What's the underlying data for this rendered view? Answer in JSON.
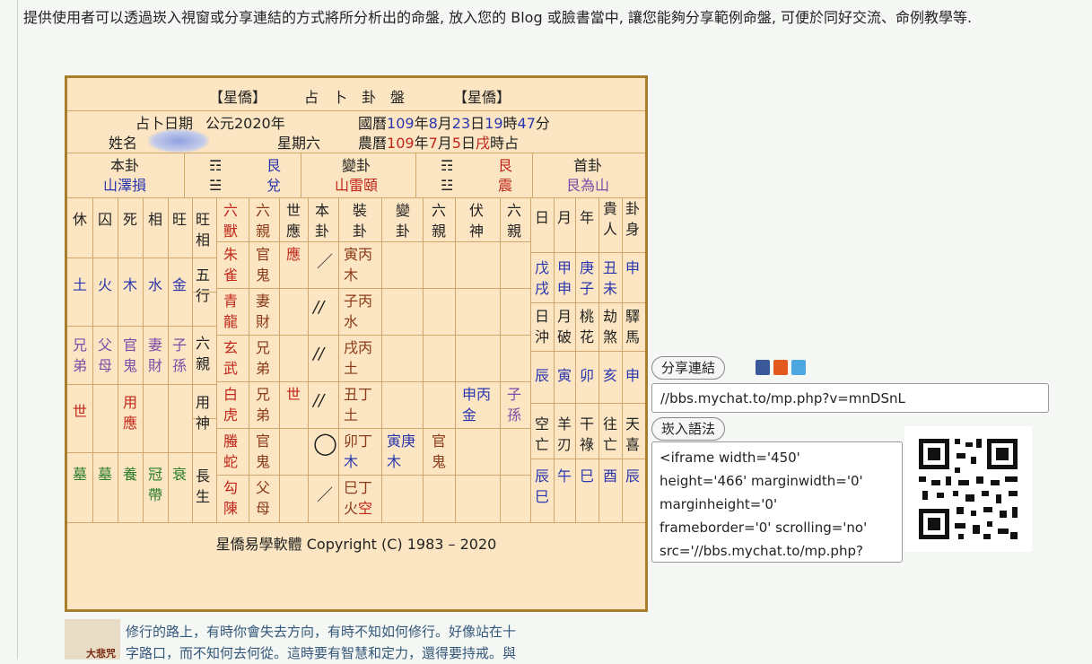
{
  "intro": {
    "text": "提供使用者可以透過崁入視窗或分享連結的方式將所分析出的命盤, 放入您的 Blog 或臉書當中, 讓您能夠分享範例命盤, 可便於同好交流、命例教學等."
  },
  "chart": {
    "title_left": "【星僑】",
    "title_mid": "占　卜　卦　盤",
    "title_right": "【星僑】",
    "date_label": "占卜日期",
    "gregorian_year": "公元2020年",
    "guoli": "國曆",
    "guoli_year": "109",
    "guoli_y": "年",
    "guoli_month": "8",
    "guoli_m": "月",
    "guoli_day": "23",
    "guoli_d": "日",
    "guoli_hour": "19",
    "guoli_h": "時",
    "guoli_min": "47",
    "guoli_mi": "分",
    "name_label": "姓名",
    "weekday": "星期六",
    "nongli": "農曆",
    "nongli_year": "109",
    "nongli_y": "年",
    "nongli_month": "7",
    "nongli_m": "月",
    "nongli_day": "5",
    "nongli_d": "日",
    "nongli_shi": "戌",
    "nongli_tail": "時占",
    "ben_gua_label": "本卦",
    "ben_gua_name": "山澤損",
    "ben_upper": "艮",
    "ben_lower": "兌",
    "bian_gua_label": "變卦",
    "bian_gua_name": "山雷頤",
    "bian_upper": "艮",
    "bian_lower": "震",
    "shou_gua_label": "首卦",
    "shou_gua_name": "艮為山",
    "col_headers": [
      "休",
      "囚",
      "死",
      "相",
      "旺"
    ],
    "wang_xiang": "旺相",
    "wuxing_label": "五行",
    "wuxing": [
      "土",
      "火",
      "木",
      "水",
      "金"
    ],
    "liuqin_label": "六親",
    "liuqin": [
      "兄弟",
      "父母",
      "官鬼",
      "妻財",
      "子孫"
    ],
    "shi": "世",
    "yong_ying": "用應",
    "yongshen_label": "用神",
    "changsheng_label": "長生",
    "changsheng": [
      "墓",
      "墓",
      "養",
      "冠帶",
      "衰"
    ],
    "yao_headers": [
      "六獸",
      "六親",
      "世應",
      "本卦",
      "裝卦",
      "變卦",
      "六親",
      "伏神",
      "六親"
    ],
    "yao_rows": [
      {
        "shou": "朱雀",
        "qin": "官鬼",
        "sy": "應",
        "mark": "／",
        "zhuang1": "寅丙",
        "zhuang2": "木",
        "bian1": "",
        "bian2": "",
        "bqin": "",
        "fu1": "",
        "fu2": "",
        "fqin": ""
      },
      {
        "shou": "青龍",
        "qin": "妻財",
        "sy": "",
        "mark": "//",
        "zhuang1": "子丙",
        "zhuang2": "水",
        "bian1": "",
        "bian2": "",
        "bqin": "",
        "fu1": "",
        "fu2": "",
        "fqin": ""
      },
      {
        "shou": "玄武",
        "qin": "兄弟",
        "sy": "",
        "mark": "//",
        "zhuang1": "戌丙",
        "zhuang2": "土",
        "bian1": "",
        "bian2": "",
        "bqin": "",
        "fu1": "",
        "fu2": "",
        "fqin": ""
      },
      {
        "shou": "白虎",
        "qin": "兄弟",
        "sy": "世",
        "mark": "//",
        "zhuang1": "丑丁",
        "zhuang2": "土",
        "bian1": "",
        "bian2": "",
        "bqin": "",
        "fu1": "申丙",
        "fu2": "金",
        "fqin": "子孫"
      },
      {
        "shou": "螣蛇",
        "qin": "官鬼",
        "sy": "",
        "mark": "◯",
        "zhuang1": "卯丁",
        "zhuang2": "木",
        "bian1": "寅庚",
        "bian2": "木",
        "bqin": "官鬼",
        "fu1": "",
        "fu2": "",
        "fqin": ""
      },
      {
        "shou": "勾陳",
        "qin": "父母",
        "sy": "",
        "mark": "／",
        "zhuang1": "巳丁",
        "zhuang2": "火",
        "zhuang2b": "空",
        "bian1": "",
        "bian2": "",
        "bqin": "",
        "fu1": "",
        "fu2": "",
        "fqin": ""
      }
    ],
    "right_headers": [
      "日",
      "月",
      "年",
      "貴人",
      "卦身"
    ],
    "right_row1": [
      "戊戌",
      "甲申",
      "庚子",
      "丑未",
      "申"
    ],
    "right_labels2": [
      "日沖",
      "月破",
      "桃花",
      "劫煞",
      "驛馬"
    ],
    "right_row2": [
      "辰",
      "寅",
      "卯",
      "亥",
      "申"
    ],
    "right_labels3": [
      "空亡",
      "羊刃",
      "干祿",
      "往亡",
      "天喜"
    ],
    "right_row3": [
      "辰巳",
      "午",
      "巳",
      "酉",
      "辰"
    ],
    "copyright": "星僑易學軟體 Copyright (C) 1983 – 2020"
  },
  "share": {
    "share_label": "分享連結",
    "url": "//bbs.mychat.to/mp.php?v=mnDSnL",
    "embed_label": "崁入語法",
    "embed_lines": [
      "<iframe width='450'",
      "height='466' marginwidth='0'",
      "marginheight='0'",
      "frameborder='0' scrolling='no'",
      "src='//bbs.mychat.to/mp.php?"
    ],
    "icon_colors": [
      "#3b5998",
      "#e2581f",
      "#4da7de"
    ],
    "icon_names": [
      "facebook-icon",
      "plurk-icon",
      "twitter-icon"
    ]
  },
  "footer": {
    "avatar_caption": "大悲咒",
    "line1": "修行的路上，有時你會失去方向，有時不知如何修行。好像站在十",
    "line2": "字路口，而不知何去何從。這時要有智慧和定力，還得要持戒。與"
  }
}
